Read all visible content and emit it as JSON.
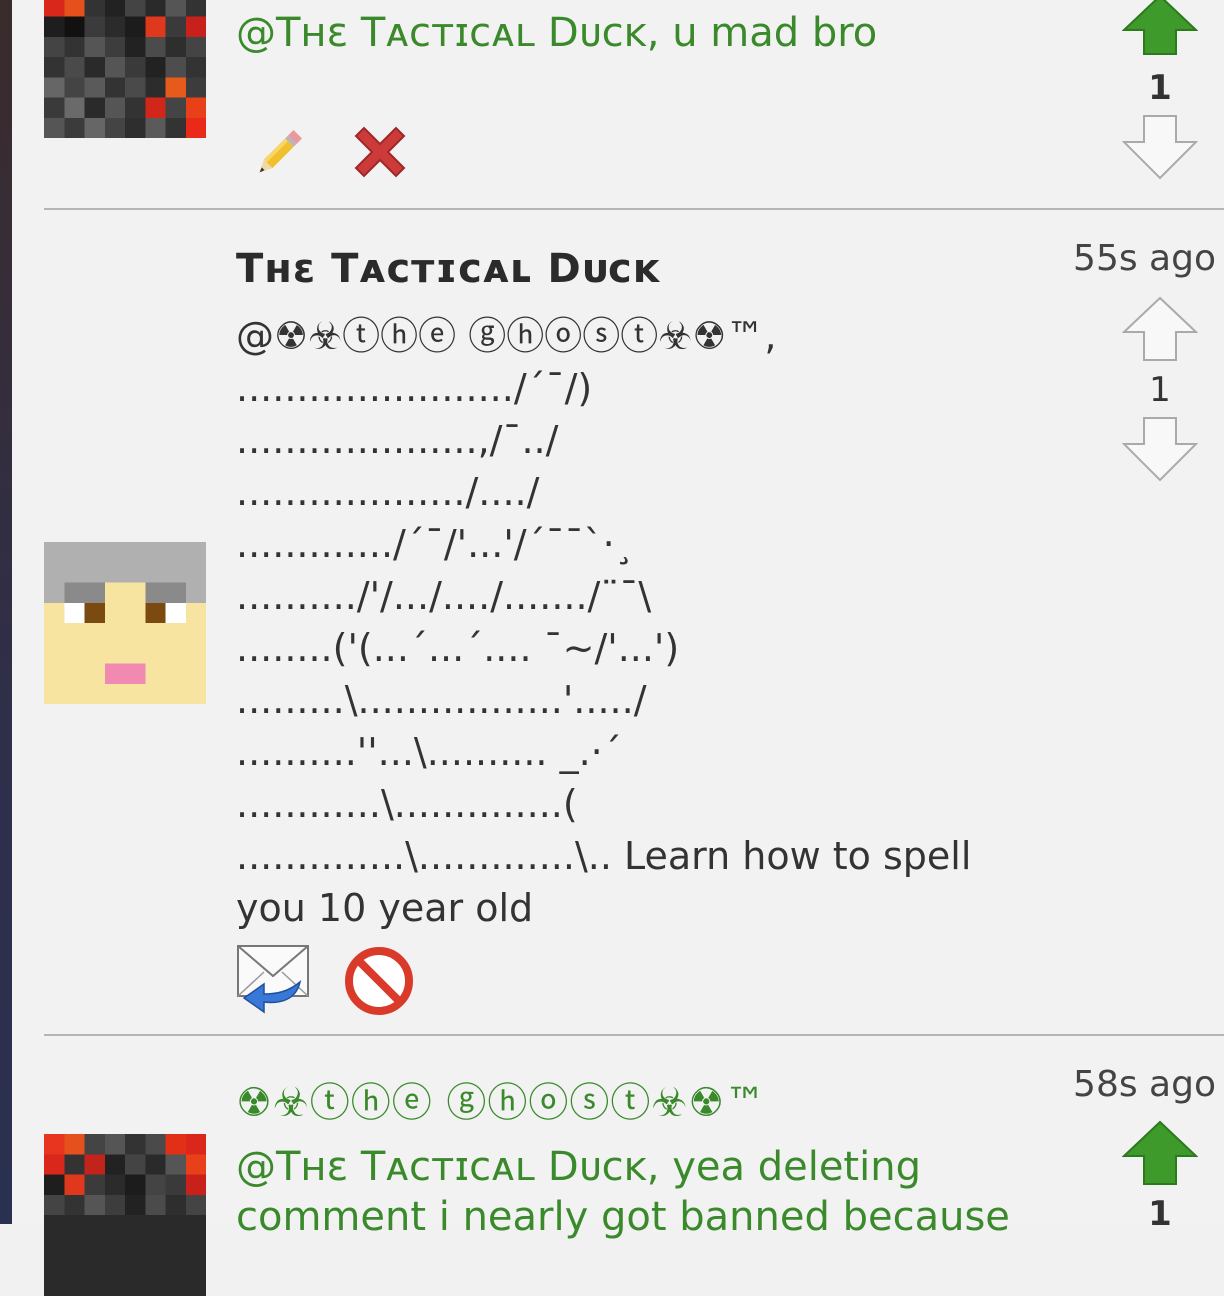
{
  "comments": [
    {
      "author": "",
      "text": "@Tʜɛ Tᴀᴄᴛɪᴄᴀʟ Dᴜᴄᴋ, u mad bro",
      "timestamp": "",
      "score": "1",
      "actions": [
        "pencil-icon",
        "delete-icon"
      ]
    },
    {
      "author": "Tʜɛ Tᴀᴄᴛɪᴄᴀʟ Dᴜᴄᴋ",
      "text": "@☢☣ⓣⓗⓔ ⓖⓗⓞⓢⓣ☣☢™,\n......................./´¯/)\n....................,/¯../\n.................../..../\n............./´¯/'...'/´¯¯`·¸\n........../'/.../..../......./¨¯\\\n........('(...´...´.... ¯~/'...')\n.........\\.................'...../\n..........''...\\.......... _.·´\n............\\..............(\n..............\\.............\\.. Learn how to spell you 10 year old",
      "timestamp": "55s ago",
      "score": "1",
      "actions": [
        "reply-mail-icon",
        "block-icon"
      ]
    },
    {
      "author": "☢☣ⓣⓗⓔ ⓖⓗⓞⓢⓣ☣☢™",
      "text": "@Tʜɛ Tᴀᴄᴛɪᴄᴀʟ Dᴜᴄᴋ, yea deleting\ncomment i nearly got banned because",
      "timestamp": "58s ago",
      "score": "1"
    }
  ],
  "colors": {
    "accent_green": "#3a8a2c",
    "upvote_active": "#3e9a2a",
    "delete_red": "#cc3a3a"
  }
}
